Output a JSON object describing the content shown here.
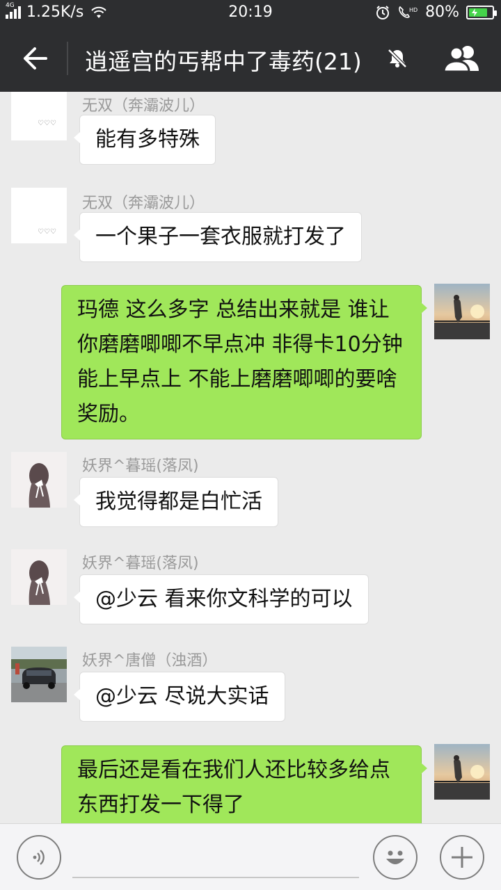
{
  "status_bar": {
    "network": "4G",
    "speed": "1.25K/s",
    "time": "20:19",
    "battery_percent": "80%",
    "battery_level": 0.8,
    "icons": [
      "signal-icon",
      "wifi-icon",
      "alarm-icon",
      "hd-call-icon",
      "battery-icon"
    ]
  },
  "header": {
    "title": "逍遥宫的丐帮中了毒药(21)",
    "icons": [
      "back-arrow-icon",
      "mute-bell-icon",
      "group-members-icon"
    ]
  },
  "messages": [
    {
      "side": "in",
      "sender": "无双（奔灞波儿）",
      "text": "能有多特殊",
      "avatar": "hearts-avatar"
    },
    {
      "side": "in",
      "sender": "无双（奔灞波儿）",
      "text": "一个果子一套衣服就打发了",
      "avatar": "hearts-avatar"
    },
    {
      "side": "out",
      "text": "玛德 这么多字 总结出来就是 谁让你磨磨唧唧不早点冲 非得卡10分钟 能上早点上 不能上磨磨唧唧的要啥奖励。",
      "avatar": "sunset-avatar"
    },
    {
      "side": "in",
      "sender": "妖界^暮瑶(落凤)",
      "text": "我觉得都是白忙活",
      "avatar": "girl-avatar"
    },
    {
      "side": "in",
      "sender": "妖界^暮瑶(落凤)",
      "text": "@少云 看来你文科学的可以",
      "avatar": "girl-avatar"
    },
    {
      "side": "in",
      "sender": "妖界^唐僧（浊酒）",
      "text": "@少云 尽说大实话",
      "avatar": "car-avatar"
    },
    {
      "side": "out",
      "text": "最后还是看在我们人还比较多给点东西打发一下得了",
      "avatar": "sunset-avatar"
    }
  ],
  "avatar_text": {
    "hearts": "♡♡♡"
  },
  "input_bar": {
    "icons": [
      "voice-icon",
      "emoji-icon",
      "plus-icon"
    ]
  },
  "colors": {
    "header_bg": "#2d2e30",
    "chat_bg": "#ebebeb",
    "outgoing_bubble": "#a0e75a",
    "incoming_bubble": "#ffffff",
    "battery_fill": "#45d34a"
  }
}
